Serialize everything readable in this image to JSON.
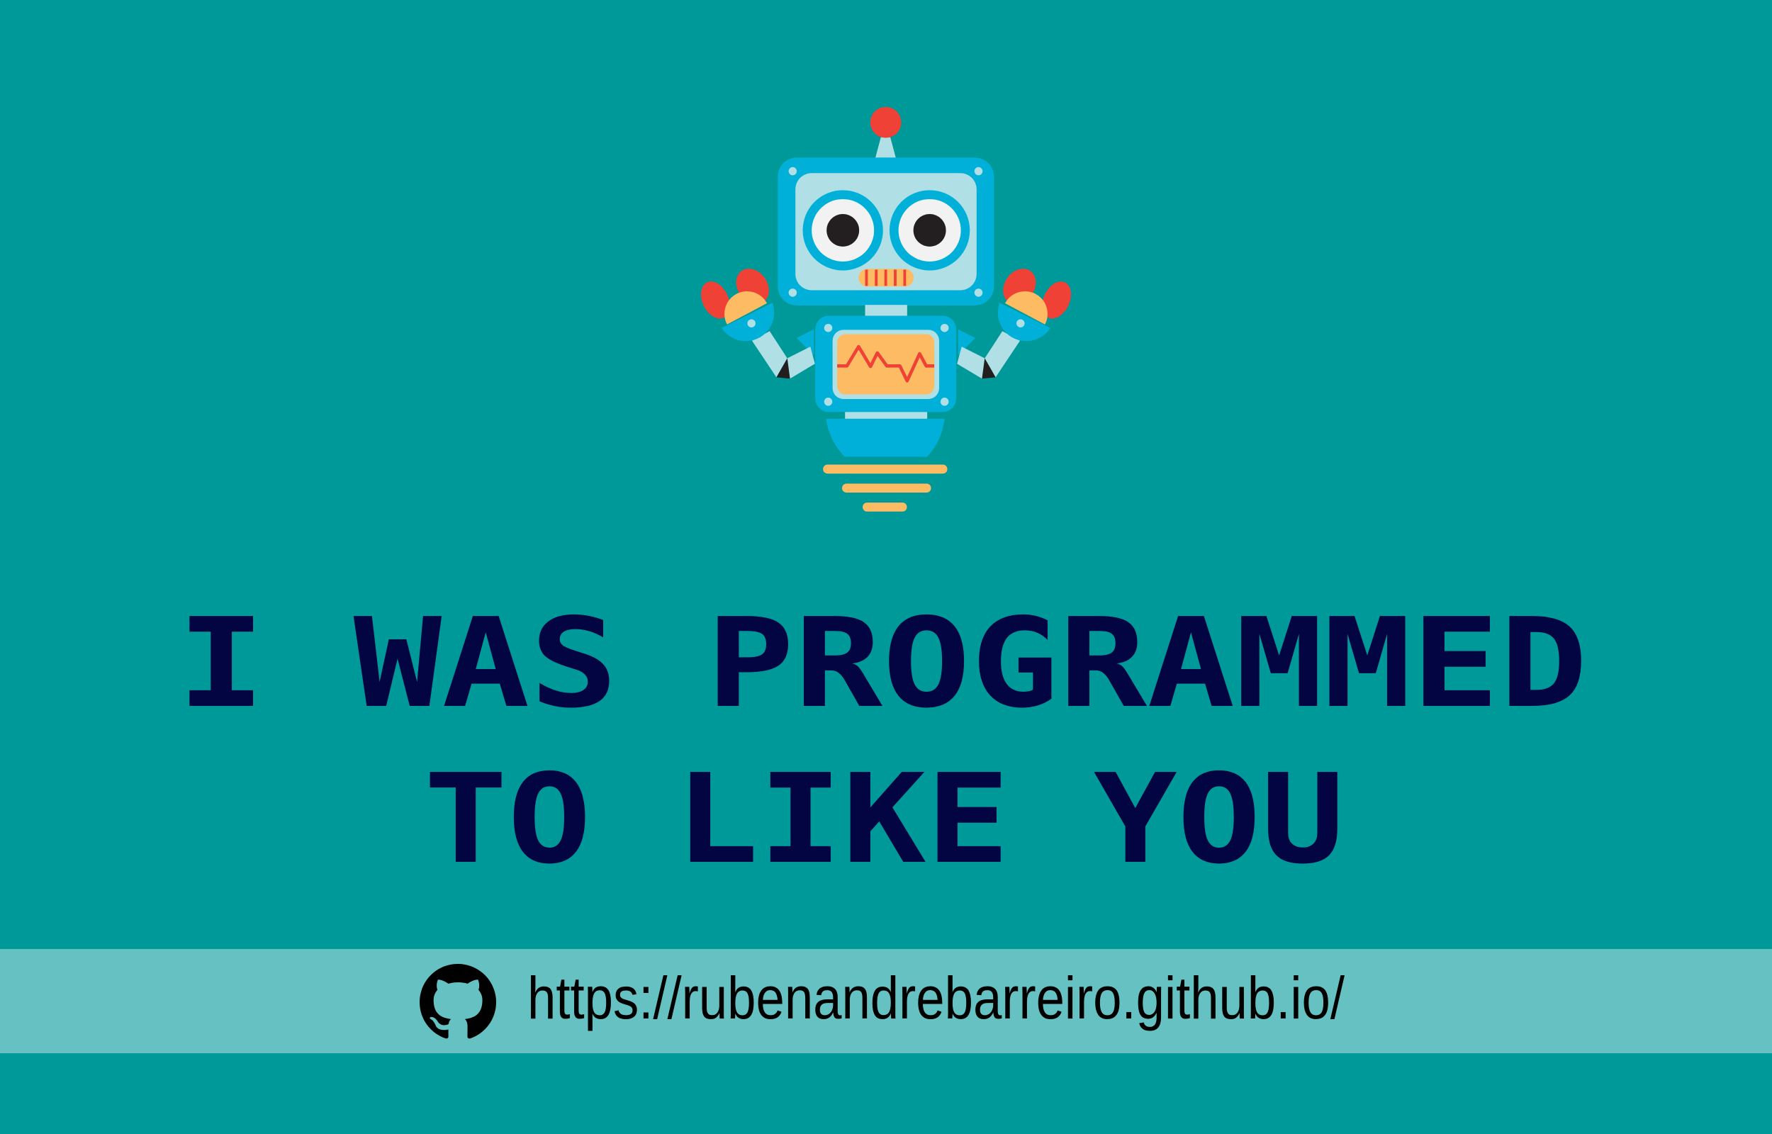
{
  "title": {
    "lines": [
      "I WAS PROGRAMMED",
      "TO LIKE YOU"
    ],
    "color": "#020542"
  },
  "footer": {
    "icon": "github-icon",
    "url": "https://rubenandrebarreiro.github.io/"
  },
  "colors": {
    "background": "#009999",
    "band": "#66c2c2",
    "robot_blue": "#00b0d8",
    "robot_light": "#b0e0e6",
    "robot_red": "#ef4136",
    "robot_orange": "#fdbb63"
  }
}
